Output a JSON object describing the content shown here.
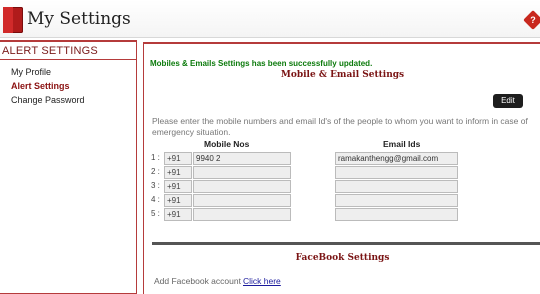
{
  "header": {
    "title": "My Settings",
    "logo_text": "My Settings"
  },
  "sidebar": {
    "title": "ALERT SETTINGS",
    "items": [
      {
        "label": "My Profile",
        "active": false
      },
      {
        "label": "Alert Settings",
        "active": true
      },
      {
        "label": "Change Password",
        "active": false
      }
    ]
  },
  "main": {
    "success_message": "Mobiles & Emails Settings has been successfully updated.",
    "section_title": "Mobile & Email Settings",
    "edit_label": "Edit",
    "instructions": "Please enter the mobile numbers and email Id's of the people to whom you want to inform in case of emergency situation.",
    "columns": {
      "mobile": "Mobile Nos",
      "email": "Email Ids"
    },
    "rows": [
      {
        "num": "1 :",
        "code": "+91",
        "mobile": "9940        2",
        "email": "ramakanthengg@gmail.com"
      },
      {
        "num": "2 :",
        "code": "+91",
        "mobile": "",
        "email": ""
      },
      {
        "num": "3 :",
        "code": "+91",
        "mobile": "",
        "email": ""
      },
      {
        "num": "4 :",
        "code": "+91",
        "mobile": "",
        "email": ""
      },
      {
        "num": "5 :",
        "code": "+91",
        "mobile": "",
        "email": ""
      }
    ],
    "facebook_title": "FaceBook Settings",
    "facebook_text": "Add Facebook account",
    "facebook_link": "Click here"
  },
  "colors": {
    "accent": "#b53b3b",
    "success": "#0b7a0b",
    "section_title": "#7a1414"
  }
}
